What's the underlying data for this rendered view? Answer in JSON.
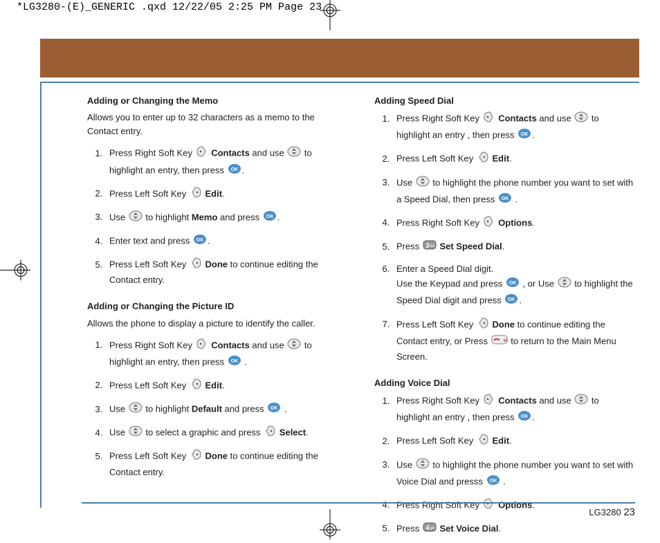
{
  "cropHeader": "*LG3280-(E)_GENERIC .qxd  12/22/05  2:25 PM  Page 23",
  "footer": {
    "model": "LG3280",
    "page": "23"
  },
  "left": {
    "memo": {
      "title": "Adding or Changing the Memo",
      "intro": "Allows you to enter up to 32 characters as a memo to the Contact entry.",
      "s1a": "Press Right Soft Key ",
      "s1b": " and use ",
      "s1c": " to highlight an entry, then press ",
      "s1bold": "Contacts",
      "s2a": "Press Left Soft Key ",
      "s2bold": "Edit",
      "s3a": "Use ",
      "s3b": " to highlight ",
      "s3bold": "Memo",
      "s3c": " and press ",
      "s4a": "Enter text and press ",
      "s5a": "Press Left Soft Key ",
      "s5bold": "Done",
      "s5b": " to continue editing the Contact entry."
    },
    "picture": {
      "title": "Adding or Changing the Picture ID",
      "intro": "Allows the phone to display a picture to identify the caller.",
      "s1a": "Press Right Soft Key ",
      "s1bold": "Contacts",
      "s1b": " and use ",
      "s1c": " to highlight an entry, then press ",
      "s2a": "Press Left Soft Key ",
      "s2bold": "Edit",
      "s3a": "Use ",
      "s3b": " to highlight ",
      "s3bold": "Default",
      "s3c": " and press ",
      "s4a": "Use ",
      "s4b": " to select a graphic and press ",
      "s4bold": "Select",
      "s5a": "Press Left Soft Key ",
      "s5bold": "Done",
      "s5b": " to continue editing the Contact entry."
    }
  },
  "right": {
    "speed": {
      "title": "Adding Speed Dial",
      "s1a": "Press Right Soft Key ",
      "s1bold": "Contacts",
      "s1b": " and use ",
      "s1c": " to highlight an entry , then press ",
      "s2a": "Press Left Soft Key ",
      "s2bold": "Edit",
      "s3a": "Use ",
      "s3b": " to highlight the phone number you want to set with a Speed Dial, then press ",
      "s4a": "Press Right Soft Key ",
      "s4bold": "Options",
      "s5a": "Press ",
      "s5bold": "Set Speed Dial",
      "s6a": "Enter a Speed Dial digit.",
      "s6b": "Use the Keypad and press ",
      "s6c": " , or Use ",
      "s6d": " to highlight the Speed Dial digit and press ",
      "s7a": "Press Left Soft Key ",
      "s7bold": "Done",
      "s7b": " to continue editing the Contact entry, or Press ",
      "s7c": " to return to the Main Menu Screen."
    },
    "voice": {
      "title": "Adding Voice Dial",
      "s1a": "Press Right Soft Key ",
      "s1bold": "Contacts",
      "s1b": " and use ",
      "s1c": " to highlight an entry , then press ",
      "s2a": "Press Left Soft Key ",
      "s2bold": "Edit",
      "s3a": "Use ",
      "s3b": " to highlight the phone number you want to set with Voice Dial and presss ",
      "s4a": "Press Right Soft Key ",
      "s4bold": "Options",
      "s5a": "Press ",
      "s5bold": "Set Voice Dial"
    }
  }
}
